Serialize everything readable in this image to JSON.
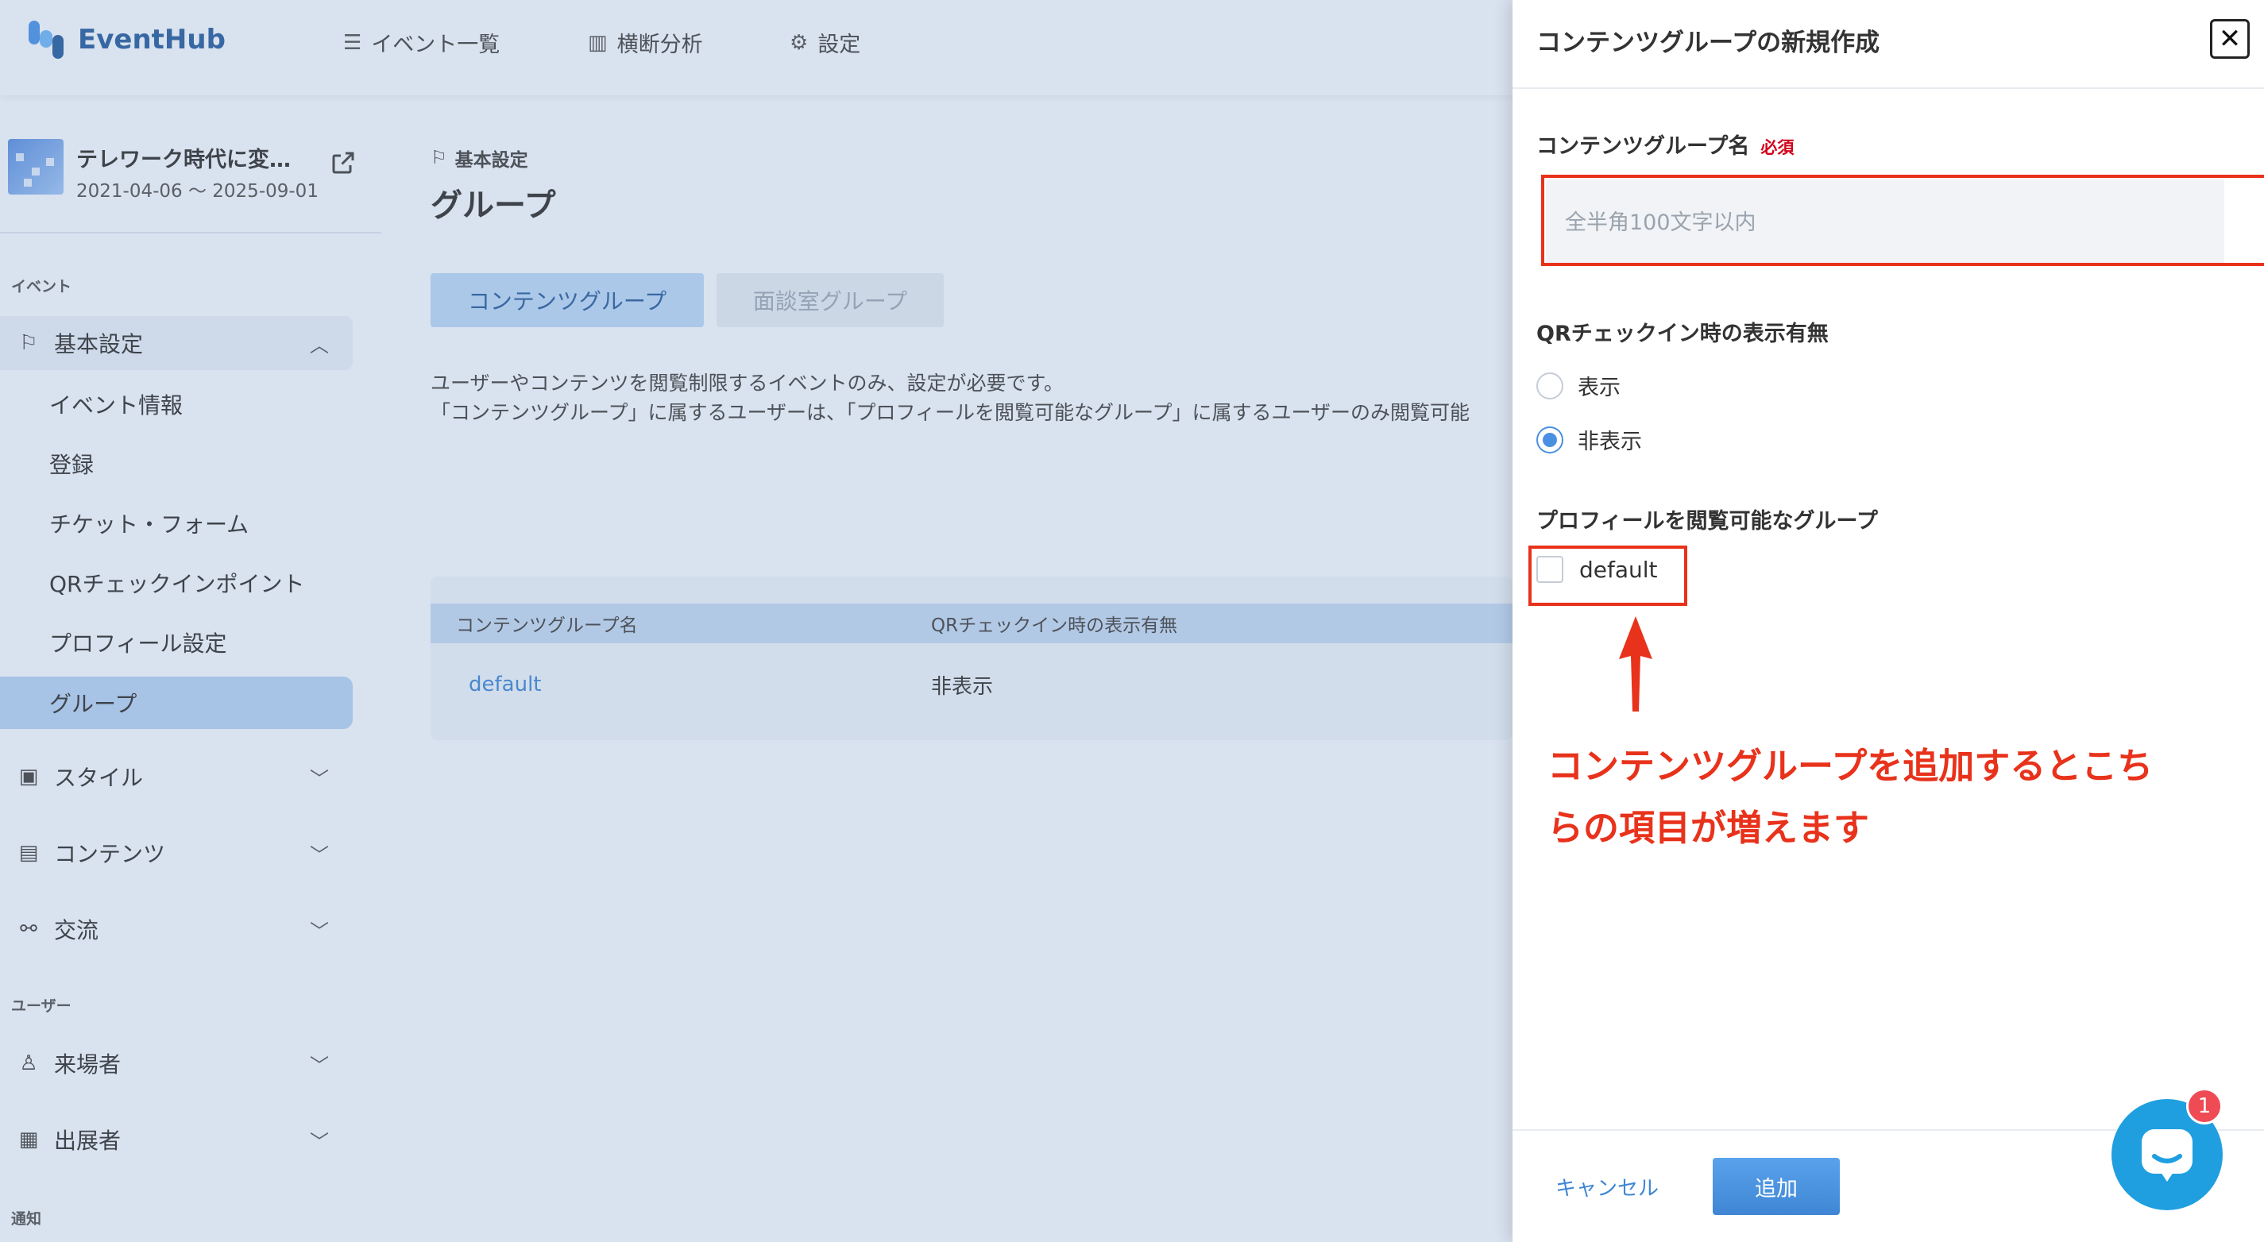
{
  "app": {
    "logo_text": "EventHub",
    "nav": [
      {
        "label": "イベント一覧",
        "icon": "list-icon"
      },
      {
        "label": "横断分析",
        "icon": "bar-chart-icon"
      },
      {
        "label": "設定",
        "icon": "gear-icon"
      }
    ]
  },
  "event": {
    "title": "テレワーク時代に変…",
    "dates": "2021-04-06 〜 2025-09-01"
  },
  "sidebar": {
    "section_event": "イベント",
    "section_user": "ユーザー",
    "section_notice": "通知",
    "basic": "基本設定",
    "sub_items": [
      "イベント情報",
      "登録",
      "チケット・フォーム",
      "QRチェックインポイント",
      "プロフィール設定",
      "グループ"
    ],
    "style": "スタイル",
    "contents": "コンテンツ",
    "exchange": "交流",
    "visitors": "来場者",
    "exhibitors": "出展者"
  },
  "main": {
    "breadcrumb": "基本設定",
    "title": "グループ",
    "tabs": [
      "コンテンツグループ",
      "面談室グループ"
    ],
    "desc_line1": "ユーザーやコンテンツを閲覧制限するイベントのみ、設定が必要です。",
    "desc_line2": "「コンテンツグループ」に属するユーザーは、「プロフィールを閲覧可能なグループ」に属するユーザーのみ閲覧可能",
    "table": {
      "headers": [
        "コンテンツグループ名",
        "QRチェックイン時の表示有無"
      ],
      "rows": [
        [
          "default",
          "非表示"
        ]
      ]
    }
  },
  "drawer": {
    "title": "コンテンツグループの新規作成",
    "close": "✕",
    "name_label": "コンテンツグループ名",
    "required": "必須",
    "name_placeholder": "全半角100文字以内",
    "name_value": "",
    "qr_label": "QRチェックイン時の表示有無",
    "qr_options": [
      "表示",
      "非表示"
    ],
    "qr_selected": "非表示",
    "profile_label": "プロフィールを閲覧可能なグループ",
    "profile_option": "default",
    "annotation_line1": "コンテンツグループを追加するとこち",
    "annotation_line2": "らの項目が増えます",
    "cancel": "キャンセル",
    "add": "追加",
    "chat_badge": "1"
  },
  "colors": {
    "accent": "#4a90e2",
    "annotation": "#e8321b",
    "sidebar_active": "#b1cdef"
  }
}
